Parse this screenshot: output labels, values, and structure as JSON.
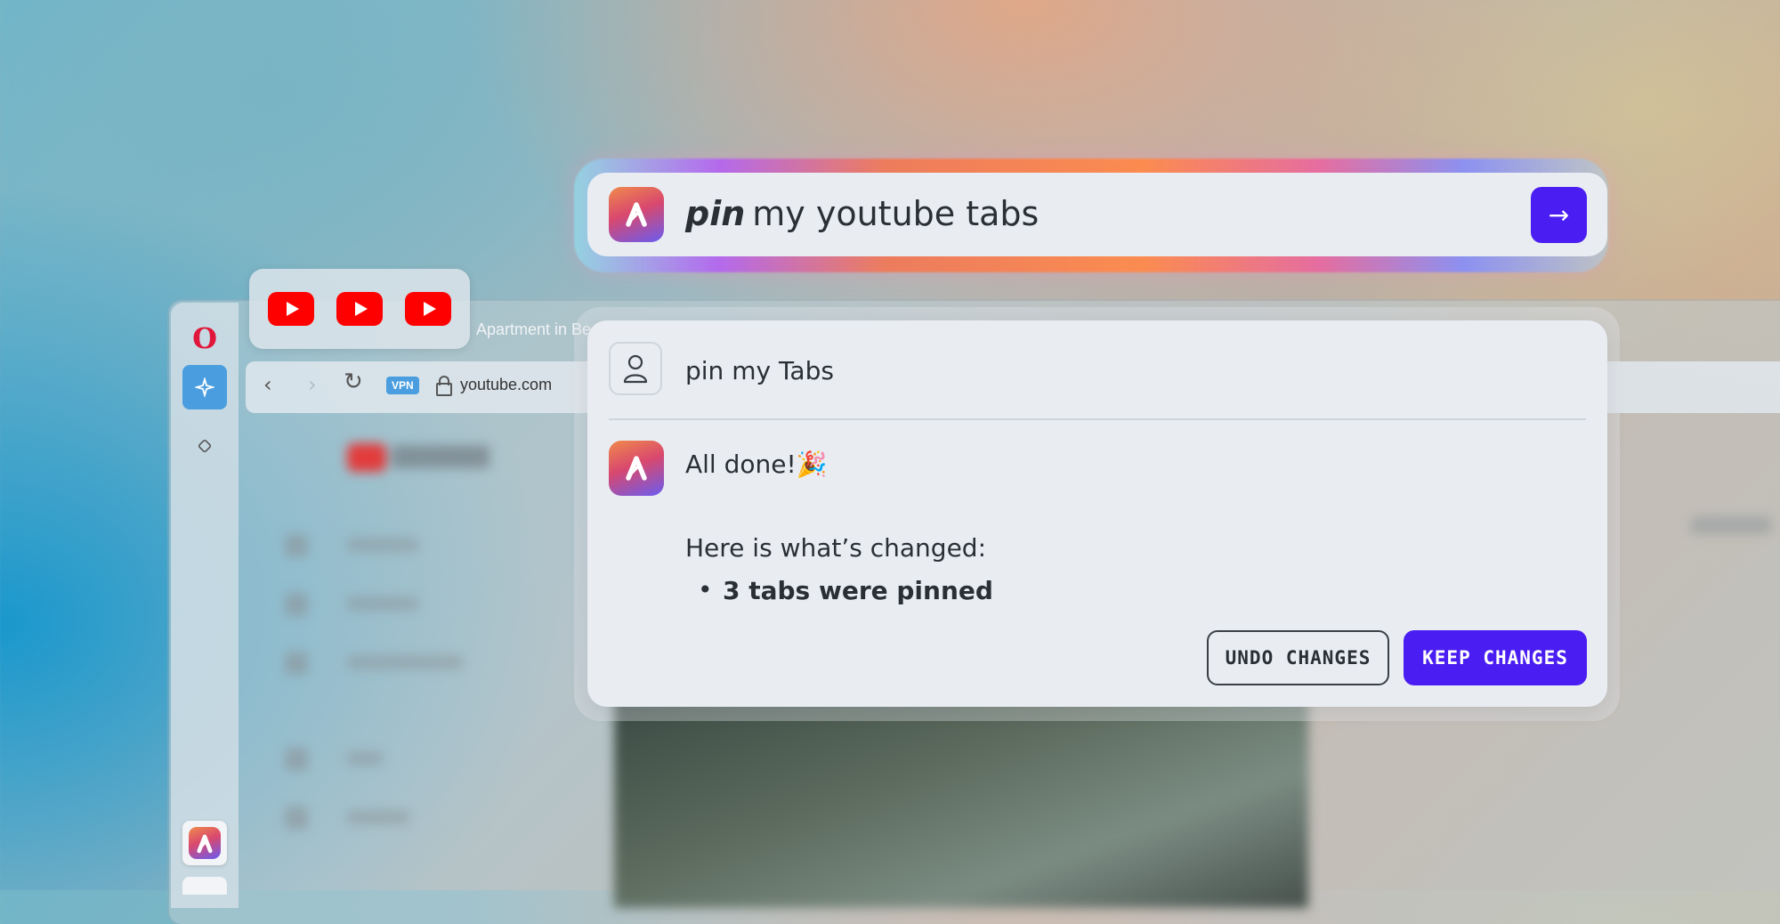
{
  "browser": {
    "tab_title": "Apartment in Be",
    "url": "youtube.com",
    "vpn_label": "VPN",
    "pinned_tabs": [
      "youtube",
      "youtube",
      "youtube"
    ]
  },
  "prompt": {
    "bold_word": "pin",
    "rest": "my youtube tabs",
    "send_icon": "→"
  },
  "conversation": {
    "user_message": "pin my Tabs",
    "assistant_done": "All done!",
    "assistant_emoji": "🎉",
    "changes_heading": "Here is what’s changed:",
    "bullet": "•",
    "change_item": "3 tabs were pinned"
  },
  "actions": {
    "undo_label": "UNDO CHANGES",
    "keep_label": "KEEP CHANGES"
  },
  "colors": {
    "accent": "#4a1ef2",
    "youtube": "#ff0000",
    "opera": "#e0163a",
    "vpn": "#4a9ee0"
  },
  "icons": {
    "send": "arrow-right-icon",
    "user": "user-icon",
    "assistant": "aria-logo-icon"
  }
}
